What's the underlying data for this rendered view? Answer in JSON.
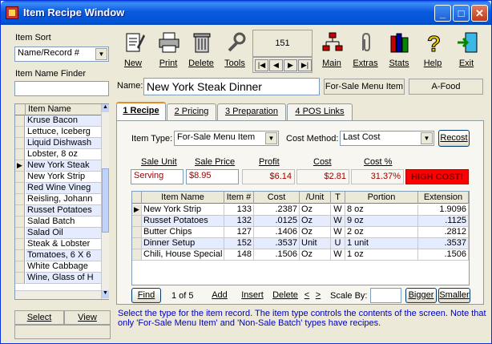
{
  "window": {
    "title": "Item Recipe Window"
  },
  "left": {
    "sort_label": "Item Sort",
    "sort_value": "Name/Record #",
    "finder_label": "Item Name Finder",
    "finder_value": "",
    "list_header": "Item Name",
    "items": [
      "Kruse Bacon",
      "Lettuce, Iceberg",
      "Liquid Dishwash",
      "Lobster, 8 oz",
      "New York Steak",
      "New York Strip",
      "Red Wine Vineg",
      "Reisling, Johann",
      "Russet Potatoes",
      "Salad Batch",
      "Salad Oil",
      "Steak & Lobster",
      "Tomatoes, 6 X 6",
      "White Cabbage",
      "Wine, Glass of H"
    ],
    "selected_index": 4,
    "select_label": "Select",
    "view_label": "View"
  },
  "toolbar": {
    "new": "New",
    "print": "Print",
    "delete": "Delete",
    "tools": "Tools",
    "record_number": "151",
    "main": "Main",
    "extras": "Extras",
    "stats": "Stats",
    "help": "Help",
    "exit": "Exit"
  },
  "header": {
    "name_label": "Name:",
    "name_value": "New York Steak Dinner",
    "type_badge": "For-Sale Menu Item",
    "category_badge": "A-Food"
  },
  "tabs": [
    "1 Recipe",
    "2 Pricing",
    "3 Preparation",
    "4 POS Links"
  ],
  "recipe": {
    "item_type_label": "Item Type:",
    "item_type_value": "For-Sale Menu Item",
    "cost_method_label": "Cost Method:",
    "cost_method_value": "Last Cost",
    "recost_label": "Recost",
    "sale_unit_label": "Sale Unit",
    "sale_price_label": "Sale Price",
    "profit_label": "Profit",
    "cost_label": "Cost",
    "cost_pct_label": "Cost %",
    "sale_unit": "Serving",
    "sale_price": "$8.95",
    "profit": "$6.14",
    "cost": "$2.81",
    "cost_pct": "31.37%",
    "warning": "HIGH COST!",
    "warning_color": "#ff0000",
    "columns": [
      "Item Name",
      "Item #",
      "Cost",
      "/Unit",
      "T",
      "Portion",
      "Extension"
    ],
    "rows": [
      [
        "New York Strip",
        "133",
        ".2387",
        "Oz",
        "W",
        "8 oz",
        "1.9096"
      ],
      [
        "Russet Potatoes",
        "132",
        ".0125",
        "Oz",
        "W",
        "9 oz",
        ".1125"
      ],
      [
        "Butter Chips",
        "127",
        ".1406",
        "Oz",
        "W",
        "2 oz",
        ".2812"
      ],
      [
        "Dinner Setup",
        "152",
        ".3537",
        "Unit",
        "U",
        "1 unit",
        ".3537"
      ],
      [
        "Chili, House Special",
        "148",
        ".1506",
        "Oz",
        "W",
        "1 oz",
        ".1506"
      ]
    ]
  },
  "bottom": {
    "find": "Find",
    "record_pos": "1 of 5",
    "add": "Add",
    "insert": "Insert",
    "delete": "Delete",
    "prev": "<",
    "next": ">",
    "scale_label": "Scale By:",
    "scale_value": "",
    "bigger": "Bigger",
    "smaller": "Smaller"
  },
  "status": "Select the type for the item record.  The item type controls the contents of the screen.  Note that only 'For-Sale Menu Item' and 'Non-Sale Batch' types have recipes."
}
